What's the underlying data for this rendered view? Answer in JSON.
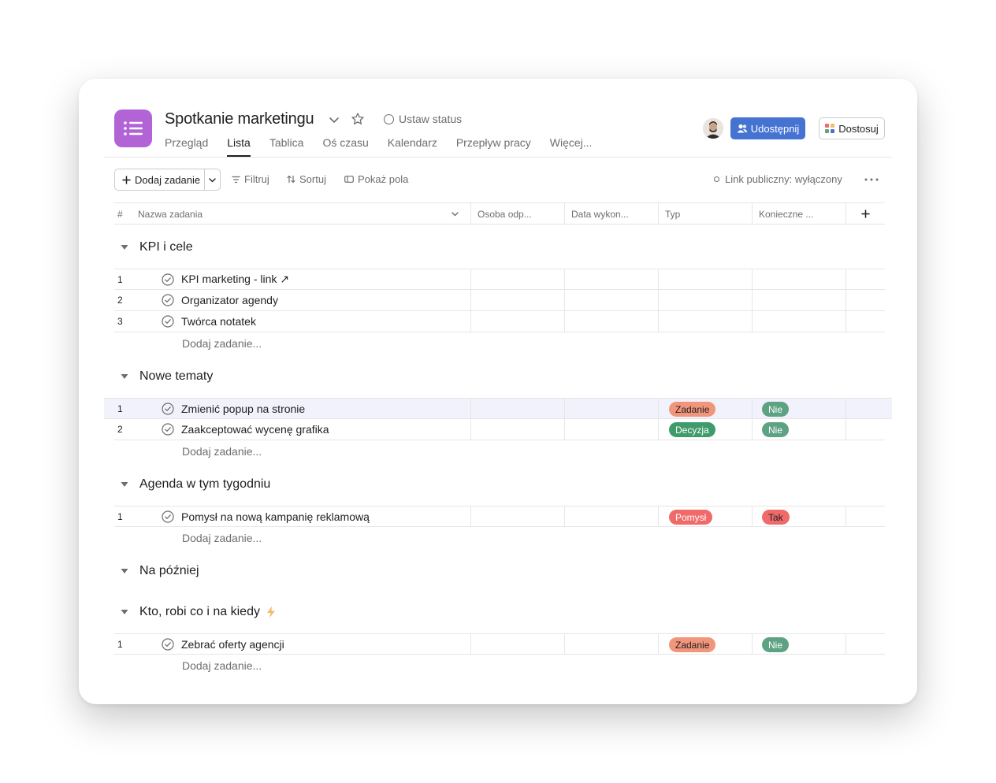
{
  "project": {
    "title": "Spotkanie marketingu",
    "status_label": "Ustaw status",
    "icon": "list-icon",
    "icon_color": "#b264d6"
  },
  "tabs": [
    {
      "label": "Przegląd",
      "active": false
    },
    {
      "label": "Lista",
      "active": true
    },
    {
      "label": "Tablica",
      "active": false
    },
    {
      "label": "Oś czasu",
      "active": false
    },
    {
      "label": "Kalendarz",
      "active": false
    },
    {
      "label": "Przepływ pracy",
      "active": false
    },
    {
      "label": "Więcej...",
      "active": false
    }
  ],
  "header_actions": {
    "share_label": "Udostępnij",
    "share_color": "#4573d2",
    "customize_label": "Dostosuj"
  },
  "toolbar": {
    "add_task_label": "Dodaj zadanie",
    "filter_label": "Filtruj",
    "sort_label": "Sortuj",
    "fields_label": "Pokaż pola",
    "public_link_label": "Link publiczny: wyłączony"
  },
  "columns": {
    "num": "#",
    "name": "Nazwa zadania",
    "assignee": "Osoba odp...",
    "due": "Data wykon...",
    "type": "Typ",
    "required": "Konieczne ..."
  },
  "add_task_inline": "Dodaj zadanie...",
  "sections": [
    {
      "title": "KPI i cele",
      "tasks": [
        {
          "num": "1",
          "name": "KPI marketing - link ↗",
          "type": "",
          "required": ""
        },
        {
          "num": "2",
          "name": "Organizator agendy",
          "type": "",
          "required": ""
        },
        {
          "num": "3",
          "name": "Twórca notatek",
          "type": "",
          "required": ""
        }
      ]
    },
    {
      "title": "Nowe tematy",
      "tasks": [
        {
          "num": "1",
          "name": "Zmienić popup na stronie",
          "type": "Zadanie",
          "required": "Nie"
        },
        {
          "num": "2",
          "name": "Zaakceptować wycenę grafika",
          "type": "Decyzja",
          "required": "Nie"
        }
      ]
    },
    {
      "title": "Agenda w tym tygodniu",
      "tasks": [
        {
          "num": "1",
          "name": "Pomysł na nową kampanię reklamową",
          "type": "Pomysł",
          "required": "Tak"
        }
      ]
    },
    {
      "title": "Na później",
      "tasks": []
    },
    {
      "title": "Kto, robi co i na kiedy",
      "title_icon": "lightning-icon",
      "tasks": [
        {
          "num": "1",
          "name": "Zebrać oferty agencji",
          "type": "Zadanie",
          "required": "Nie"
        }
      ]
    }
  ],
  "pill_colors": {
    "Zadanie": "#f1957b",
    "Decyzja": "#3f9b6b",
    "Pomysł": "#f06a6a",
    "Nie": "#5da283",
    "Tak": "#f06a6a"
  }
}
